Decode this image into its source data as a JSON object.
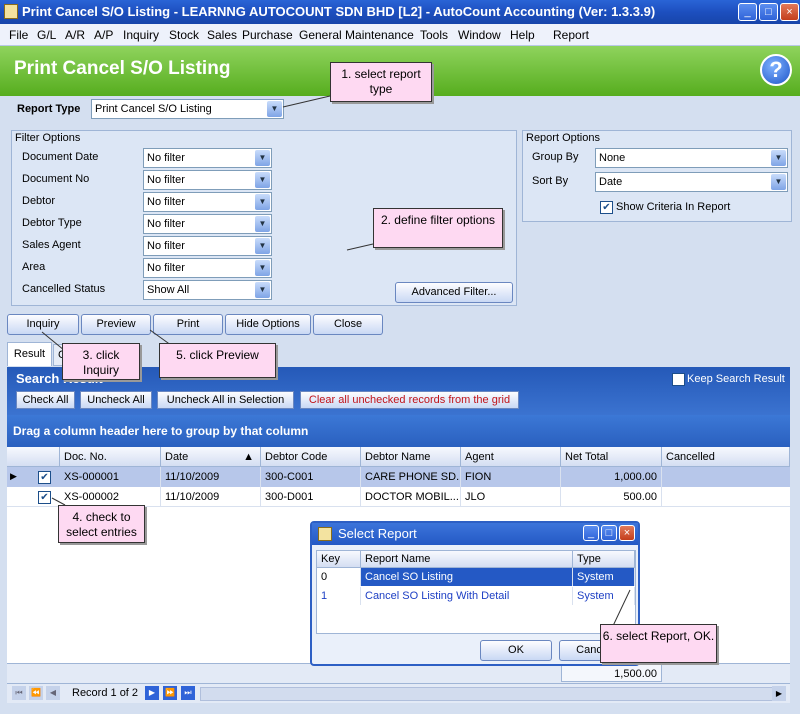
{
  "window": {
    "title": "Print Cancel S/O Listing - LEARNNG AUTOCOUNT SDN BHD [L2] - AutoCount Accounting (Ver: 1.3.3.9)",
    "minimize_glyph": "_",
    "maximize_glyph": "□",
    "close_glyph": "×"
  },
  "menu": {
    "items": [
      "File",
      "G/L",
      "A/R",
      "A/P",
      "Inquiry",
      "Stock",
      "Sales",
      "Purchase",
      "General Maintenance",
      "Tools",
      "Window",
      "Help",
      "Report"
    ]
  },
  "header": {
    "title": "Print Cancel S/O Listing",
    "help_glyph": "?"
  },
  "report_type": {
    "label": "Report Type",
    "value": "Print Cancel S/O Listing"
  },
  "filter_options": {
    "title": "Filter Options",
    "rows": [
      {
        "label": "Document Date",
        "value": "No filter"
      },
      {
        "label": "Document No",
        "value": "No filter"
      },
      {
        "label": "Debtor",
        "value": "No filter"
      },
      {
        "label": "Debtor Type",
        "value": "No filter"
      },
      {
        "label": "Sales Agent",
        "value": "No filter"
      },
      {
        "label": "Area",
        "value": "No filter"
      },
      {
        "label": "Cancelled Status",
        "value": "Show All"
      }
    ],
    "advanced_button": "Advanced Filter..."
  },
  "report_options": {
    "title": "Report Options",
    "group_by_label": "Group By",
    "group_by_value": "None",
    "sort_by_label": "Sort By",
    "sort_by_value": "Date",
    "show_criteria_label": "Show Criteria In Report",
    "show_criteria_checked": true
  },
  "actions": {
    "inquiry": "Inquiry",
    "preview": "Preview",
    "print": "Print",
    "hide_options": "Hide Options",
    "close": "Close"
  },
  "tabs": {
    "result": "Result",
    "criteria_partial": "C"
  },
  "search": {
    "title": "Search Result",
    "keep_label": "Keep Search Result",
    "check_all": "Check All",
    "uncheck_all": "Uncheck All",
    "uncheck_selection": "Uncheck All in Selection",
    "clear_unchecked": "Clear all unchecked records from the grid"
  },
  "grid": {
    "group_hint": "Drag a column header here to group by that column",
    "columns": [
      "Doc. No.",
      "Date",
      "Debtor Code",
      "Debtor Name",
      "Agent",
      "Net Total",
      "Cancelled"
    ],
    "rows": [
      {
        "doc": "XS-000001",
        "date": "11/10/2009",
        "code": "300-C001",
        "name": "CARE PHONE SD...",
        "agent": "FION",
        "total": "1,000.00"
      },
      {
        "doc": "XS-000002",
        "date": "11/10/2009",
        "code": "300-D001",
        "name": "DOCTOR MOBIL...",
        "agent": "JLO",
        "total": "500.00"
      }
    ],
    "footer_total": "1,500.00",
    "record_nav": "Record 1 of 2"
  },
  "dialog": {
    "title": "Select Report",
    "columns": [
      "Key",
      "Report Name",
      "Type"
    ],
    "rows": [
      {
        "key": "0",
        "name": "Cancel SO Listing",
        "type": "System"
      },
      {
        "key": "1",
        "name": "Cancel SO Listing With Detail",
        "type": "System"
      }
    ],
    "ok": "OK",
    "cancel_partial": "Canc"
  },
  "callouts": {
    "c1": "1. select report type",
    "c2": "2. define filter options",
    "c3": "3. click Inquiry",
    "c4": "4. check to select entries",
    "c5": "5. click Preview",
    "c6": "6. select Report, OK."
  },
  "colors": {
    "title_bar": "#2459c5",
    "header_green": "#6cbc2c",
    "callout_pink": "#fed9f2",
    "selected_row": "#b7c7ea",
    "link_blue": "#1d3fc4"
  }
}
